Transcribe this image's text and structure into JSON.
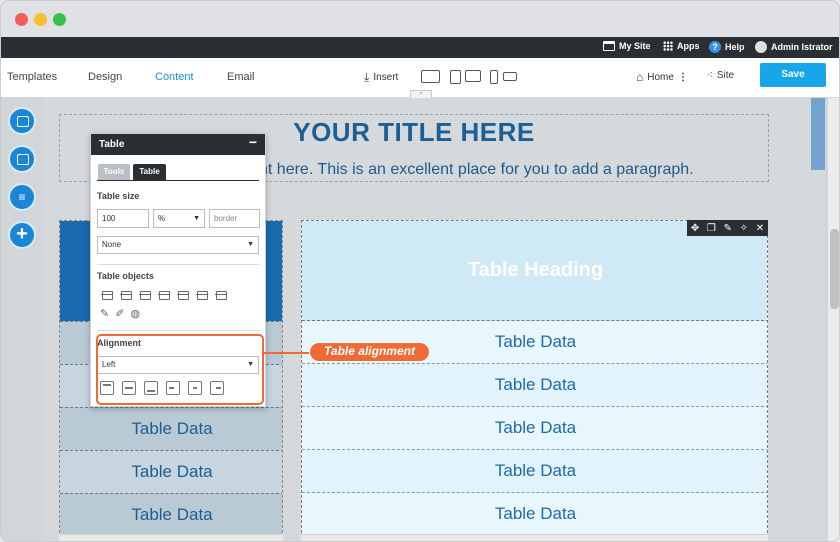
{
  "topbar": {
    "my_site": "My Site",
    "apps": "Apps",
    "help": "Help",
    "user": "Admin Istrator"
  },
  "nav": {
    "tabs": [
      {
        "label": "Templates"
      },
      {
        "label": "Design"
      },
      {
        "label": "Content",
        "active": true
      },
      {
        "label": "Email"
      }
    ],
    "insert": "Insert",
    "home": "Home",
    "site": "Site",
    "save": "Save"
  },
  "page": {
    "title": "YOUR TITLE HERE",
    "paragraph": "nt here. This is an excellent place for you to add a paragraph."
  },
  "left_table": {
    "rows": [
      "Table Data",
      "Table Data",
      "Table Data"
    ]
  },
  "main_table": {
    "heading": "Table Heading",
    "rows": [
      "Table Data",
      "Table Data",
      "Table Data",
      "Table Data",
      "Table Data"
    ]
  },
  "panel": {
    "title": "Table",
    "tabs": [
      "Tools",
      "Table"
    ],
    "table_size_label": "Table size",
    "size_value": "100",
    "unit_value": "%",
    "border_placeholder": "border",
    "style_value": "None",
    "objects_label": "Table objects",
    "alignment_label": "Alignment",
    "alignment_value": "Left"
  },
  "callout": {
    "label": "Table alignment"
  },
  "colors": {
    "accent": "#17a6ea",
    "callout": "#f06a35",
    "dark": "#2b2f33"
  }
}
